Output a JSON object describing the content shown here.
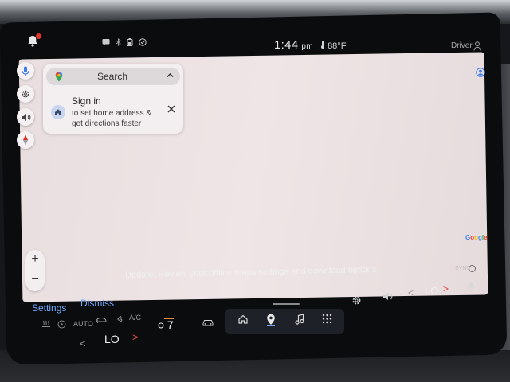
{
  "status_bar": {
    "time": "1:44",
    "ampm": "pm",
    "temperature": "88°F",
    "driver_label": "Driver",
    "icons": [
      "notification-bell-icon",
      "message-icon",
      "bluetooth-icon",
      "battery-icon",
      "check-circle-icon",
      "thermometer-icon",
      "person-icon"
    ]
  },
  "map": {
    "search_label": "Search",
    "sign_in": {
      "title": "Sign in",
      "description": "to set home address & get directions faster"
    },
    "attribution": {
      "letters": [
        "G",
        "o",
        "o",
        "g",
        "l",
        "e"
      ],
      "colors": [
        "#4285F4",
        "#EA4335",
        "#FBBC05",
        "#4285F4",
        "#34A853",
        "#EA4335"
      ]
    },
    "zoom_in": "+",
    "zoom_out": "−"
  },
  "notification": {
    "settings": "Settings",
    "dismiss": "Dismiss",
    "message": "Update: Review your offline maps settings and download options"
  },
  "dock": {
    "items": [
      "home-icon",
      "map-pin-icon",
      "music-note-icon",
      "app-grid-icon"
    ],
    "active": "map-pin-icon"
  },
  "climate": {
    "auto_label": "AUTO",
    "ac_label": "A/C",
    "fan_speed": "7",
    "left_temp": "LO",
    "right_temp": "LO",
    "sync_label": "SYNC"
  },
  "colors": {
    "accent_blue": "#6fa7ff",
    "arrow_red": "#e04a3e",
    "map_background": "#ede3e4",
    "notification_dot": "#e0342e"
  }
}
